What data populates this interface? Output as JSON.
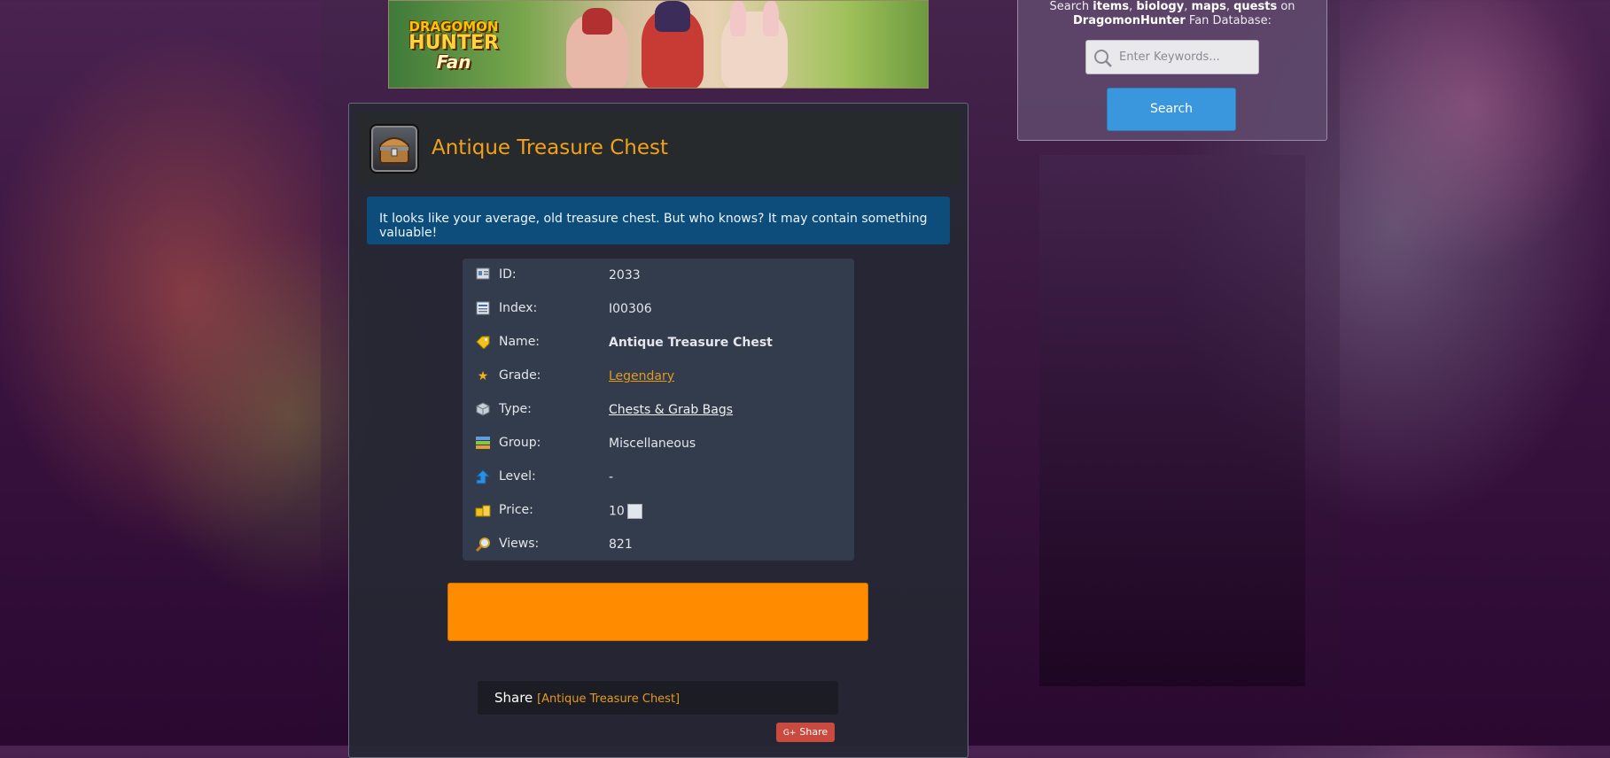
{
  "banner": {
    "logo_line1": "DRAGOMON",
    "logo_line2": "HUNTER",
    "logo_line3": "Fan"
  },
  "item": {
    "title": "Antique Treasure Chest",
    "description": "It looks like your average, old treasure chest. But who knows? It may contain something valuable!",
    "icon": "treasure-chest-icon"
  },
  "info_rows": [
    {
      "icon": "id-card-icon",
      "label": "ID:",
      "value": "2033"
    },
    {
      "icon": "index-icon",
      "label": "Index:",
      "value": "I00306"
    },
    {
      "icon": "tag-icon",
      "label": "Name:",
      "value": "Antique Treasure Chest"
    },
    {
      "icon": "star-icon",
      "label": "Grade:",
      "value": "Legendary"
    },
    {
      "icon": "cube-icon",
      "label": "Type:",
      "value": "Chests & Grab Bags"
    },
    {
      "icon": "group-icon",
      "label": "Group:",
      "value": "Miscellaneous"
    },
    {
      "icon": "level-arrow-icon",
      "label": "Level:",
      "value": "-"
    },
    {
      "icon": "coins-icon",
      "label": "Price:",
      "value": "10"
    },
    {
      "icon": "magnifier-icon",
      "label": "Views:",
      "value": "821"
    }
  ],
  "share": {
    "label": "Share",
    "item_name": "[Antique Treasure Chest]",
    "gplus_label": "Share",
    "gplus_prefix": "G+"
  },
  "search": {
    "intro_prefix": "Search ",
    "intro_items": "items",
    "intro_sep1": ", ",
    "intro_biology": "biology",
    "intro_sep2": ", ",
    "intro_maps": "maps",
    "intro_sep3": ", ",
    "intro_quests": "quests",
    "intro_on": " on",
    "intro_site": "DragomonHunter",
    "intro_suffix": " Fan Database:",
    "placeholder": "Enter Keywords...",
    "button_label": "Search"
  },
  "colors": {
    "accent_orange": "#f2a21a",
    "info_blue": "#0d4d7c",
    "search_blue": "#3a97dd",
    "cta_orange": "#ff8c00"
  }
}
